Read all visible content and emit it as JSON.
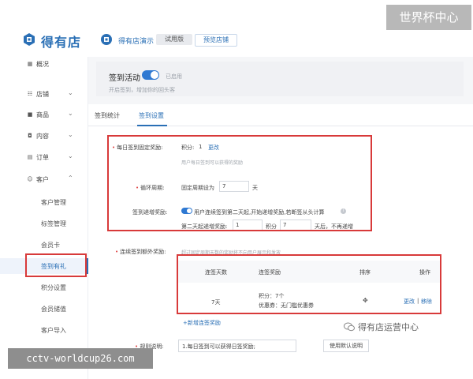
{
  "header": {
    "brand_name": "得有店",
    "shop_name": "得有店演示",
    "trial_badge": "试用版",
    "preview_button": "预览店铺"
  },
  "watermarks": {
    "top_right": "世界杯中心",
    "bottom_left": "cctv-worldcup26.com",
    "wechat": "得有店运营中心"
  },
  "sidebar": {
    "items": [
      {
        "label": "概况",
        "icon": "grid-icon"
      },
      {
        "label": "店铺",
        "icon": "store-icon",
        "chevron": "⌄"
      },
      {
        "label": "商品",
        "icon": "goods-icon",
        "chevron": "⌄"
      },
      {
        "label": "内容",
        "icon": "content-icon",
        "chevron": "⌄"
      },
      {
        "label": "订单",
        "icon": "order-icon",
        "chevron": "⌄"
      },
      {
        "label": "客户",
        "icon": "customer-icon",
        "chevron": "⌃"
      }
    ],
    "sub_items": [
      {
        "label": "客户管理"
      },
      {
        "label": "标签管理"
      },
      {
        "label": "会员卡"
      },
      {
        "label": "签到有礼",
        "active": true
      },
      {
        "label": "积分设置"
      },
      {
        "label": "会员储值"
      },
      {
        "label": "客户导入"
      }
    ]
  },
  "activity": {
    "title": "签到活动",
    "toggle_on": true,
    "status": "已启用",
    "description": "开启签到，增加你的回头客"
  },
  "tabs": [
    {
      "label": "签到统计",
      "active": false
    },
    {
      "label": "签到设置",
      "active": true
    }
  ],
  "form": {
    "daily_reward": {
      "label": "每日签到固定奖励:",
      "points_label": "积分:",
      "points_value": "1",
      "change_link": "更改",
      "hint": "用户每日签到可以获得的奖励"
    },
    "cycle": {
      "label": "循环周期:",
      "prefix": "固定周期设为",
      "value": "7",
      "suffix": "天"
    },
    "incremental": {
      "label": "签到递增奖励:",
      "toggle_on": true,
      "text": "用户连续签到第二天起,开始递增奖励,若断签从头计算",
      "line2_prefix": "第二天起递增奖励:",
      "line2_value": "1",
      "line2_mid": "积分",
      "line2_days": "7",
      "line2_suffix": "天后，不再递增"
    },
    "extra": {
      "label": "连续签到额外奖励:",
      "hint": "超过固定周期天数的奖励将不向用户展示和发放"
    },
    "table": {
      "headers": [
        "连签天数",
        "连签奖励",
        "排序",
        "操作"
      ],
      "rows": [
        {
          "days": "7天",
          "reward_points": "积分：7个",
          "reward_coupon": "优惠券：无门槛优惠券",
          "edit": "更改",
          "separator": "|",
          "remove": "移除"
        }
      ]
    },
    "add_link": "+新增连签奖励",
    "rules": {
      "label": "规则说明:",
      "value": "1.每日签到可以获得日签奖励;",
      "default_button": "使用默认说明"
    }
  },
  "colors": {
    "brand_blue": "#2a6fb5",
    "toggle_blue": "#2f79d2",
    "highlight_red": "#d83a3a"
  }
}
